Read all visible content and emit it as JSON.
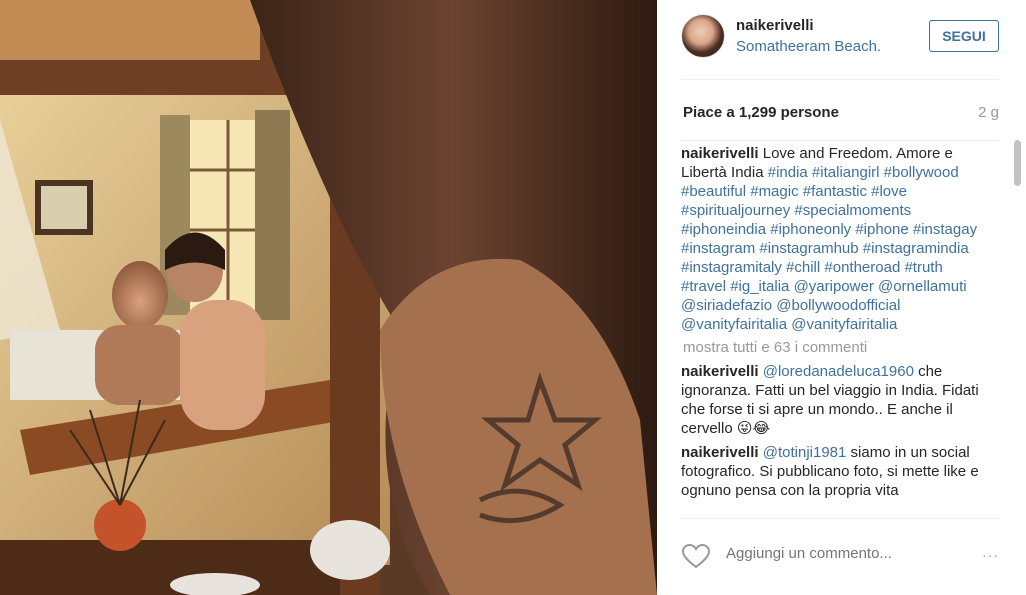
{
  "post": {
    "username": "naikerivelli",
    "location": "Somatheeram Beach.",
    "follow_label": "SEGUI",
    "likes_text": "Piace a 1,299 persone",
    "age": "2 g"
  },
  "caption": {
    "author": "naikerivelli",
    "text": " Love and Freedom. Amore e Libertà India ",
    "hashtags": "#india #italiangirl #bollywood #beautiful #magic #fantastic #love #spiritualjourney #specialmoments #iphoneindia #iphoneonly #iphone #instagay #instagram #instagramhub #instagramindia #instagramitaly #chill #ontheroad #truth #travel #ig_italia @yaripower @ornellamuti @siriadefazio @bollywoodofficial @vanityfairitalia @vanityfairitalia"
  },
  "show_all_comments": "mostra tutti e 63 i commenti",
  "comments": [
    {
      "author": "naikerivelli",
      "mention": "@loredanadeluca1960",
      "text": " che ignoranza. Fatti un bel viaggio in India. Fidati che forse ti si apre un mondo.. E anche il cervello 😜😂"
    },
    {
      "author": "naikerivelli",
      "mention": "@totinji1981",
      "text": " siamo in un social fotografico. Si pubblicano foto, si mette like e ognuno pensa con la propria vita"
    }
  ],
  "footer": {
    "add_comment_placeholder": "Aggiungi un commento...",
    "more_icon": "···",
    "like_icon": "heart-outline-icon"
  },
  "colors": {
    "link": "#3f729b",
    "muted": "#999999",
    "text": "#262626"
  }
}
